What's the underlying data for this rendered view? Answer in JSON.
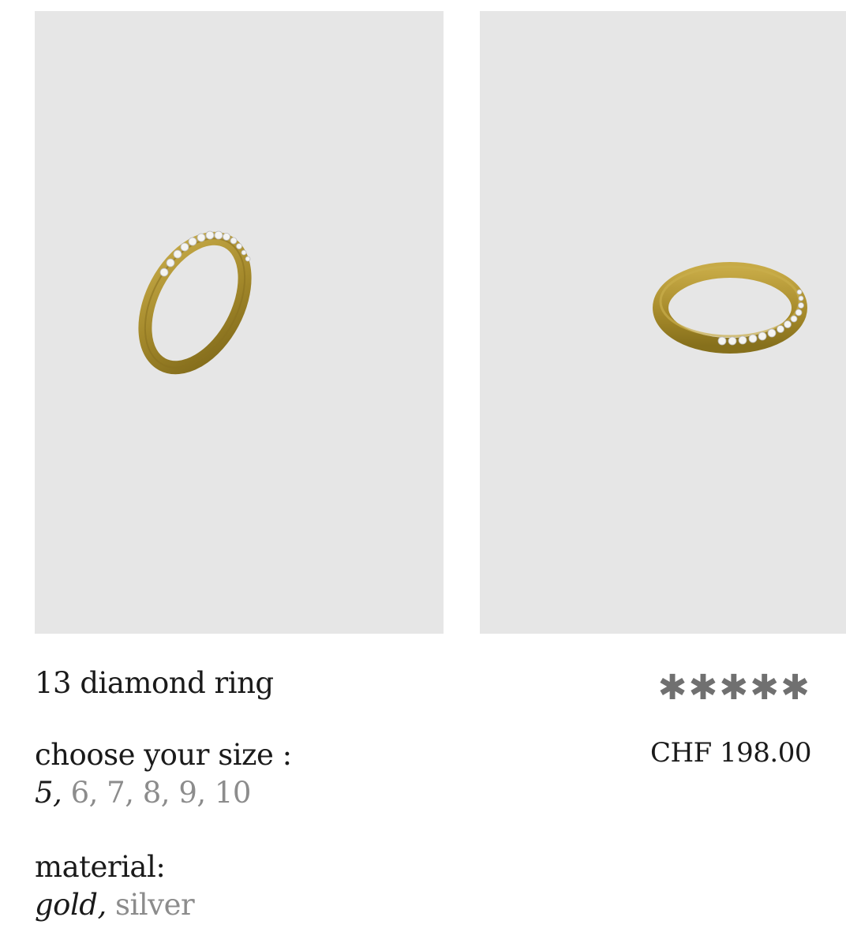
{
  "product": {
    "title": "13 diamond ring",
    "rating": "✱✱✱✱✱",
    "price": "CHF 198.00"
  },
  "images": [
    {
      "name": "ring-front-view",
      "background": "#e6e6e6"
    },
    {
      "name": "ring-side-view",
      "background": "#e6e6e6"
    }
  ],
  "size": {
    "label": "choose your size :",
    "options": [
      "5",
      "6",
      "7",
      "8",
      "9",
      "10"
    ],
    "selected": "5"
  },
  "material": {
    "label": "material:",
    "options": [
      "gold",
      "silver"
    ],
    "selected": "gold"
  },
  "colors": {
    "image_bg": "#e6e6e6",
    "gold": "#a58a2c",
    "text": "#1a1a1a",
    "muted": "#8c8c8c"
  }
}
